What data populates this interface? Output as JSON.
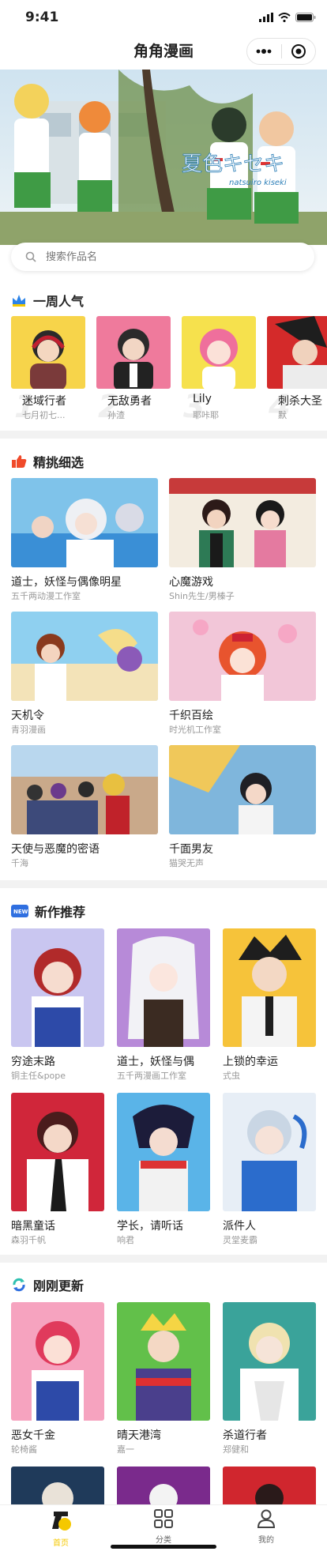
{
  "status": {
    "time": "9:41"
  },
  "nav": {
    "title": "角角漫画"
  },
  "banner": {
    "logo_text": "夏色キセキ",
    "logo_sub": "natsuiro kiseki"
  },
  "search": {
    "placeholder": "搜索作品名"
  },
  "sections": {
    "weekly": {
      "title": "一周人气"
    },
    "picks": {
      "title": "精挑细选"
    },
    "newworks": {
      "title": "新作推荐"
    },
    "updated": {
      "title": "刚刚更新"
    }
  },
  "weekly": [
    {
      "title": "迷域行者",
      "author": "七月初七...",
      "rank": "1"
    },
    {
      "title": "无敌勇者",
      "author": "孙渣",
      "rank": "2"
    },
    {
      "title": "Lily",
      "author": "耶咔耶",
      "rank": "3"
    },
    {
      "title": "刺杀大圣",
      "author": "默",
      "rank": "4"
    }
  ],
  "picks": [
    {
      "title": "道士，妖怪与偶像明星",
      "author": "五千两动漫工作室"
    },
    {
      "title": "心魔游戏",
      "author": "Shin先生/男榛子"
    },
    {
      "title": "天机令",
      "author": "青羽漫画"
    },
    {
      "title": "千织百绘",
      "author": "时光机工作室"
    },
    {
      "title": "天使与恶魔的密语",
      "author": "千海"
    },
    {
      "title": "千面男友",
      "author": "猫哭无声"
    }
  ],
  "newworks": [
    {
      "title": "穷途末路",
      "author": "铜主任&pope"
    },
    {
      "title": "道士，妖怪与偶",
      "author": "五千两漫画工作室"
    },
    {
      "title": "上锁的幸运",
      "author": "式虫"
    },
    {
      "title": "暗黑童话",
      "author": "森羽千帆"
    },
    {
      "title": "学长，请听话",
      "author": "响君"
    },
    {
      "title": "派件人",
      "author": "灵堂麦霸"
    }
  ],
  "updated": [
    {
      "title": "恶女千金",
      "author": "轮椅酱"
    },
    {
      "title": "晴天港湾",
      "author": "嘉一"
    },
    {
      "title": "杀道行者",
      "author": "郑健和"
    }
  ],
  "tabs": {
    "home": "首页",
    "category": "分类",
    "mine": "我的"
  },
  "colors": {
    "accent": "#f5c800",
    "crown": "#2b83e8",
    "thumb": "#f04a2a",
    "new": "#2f6fe0"
  }
}
